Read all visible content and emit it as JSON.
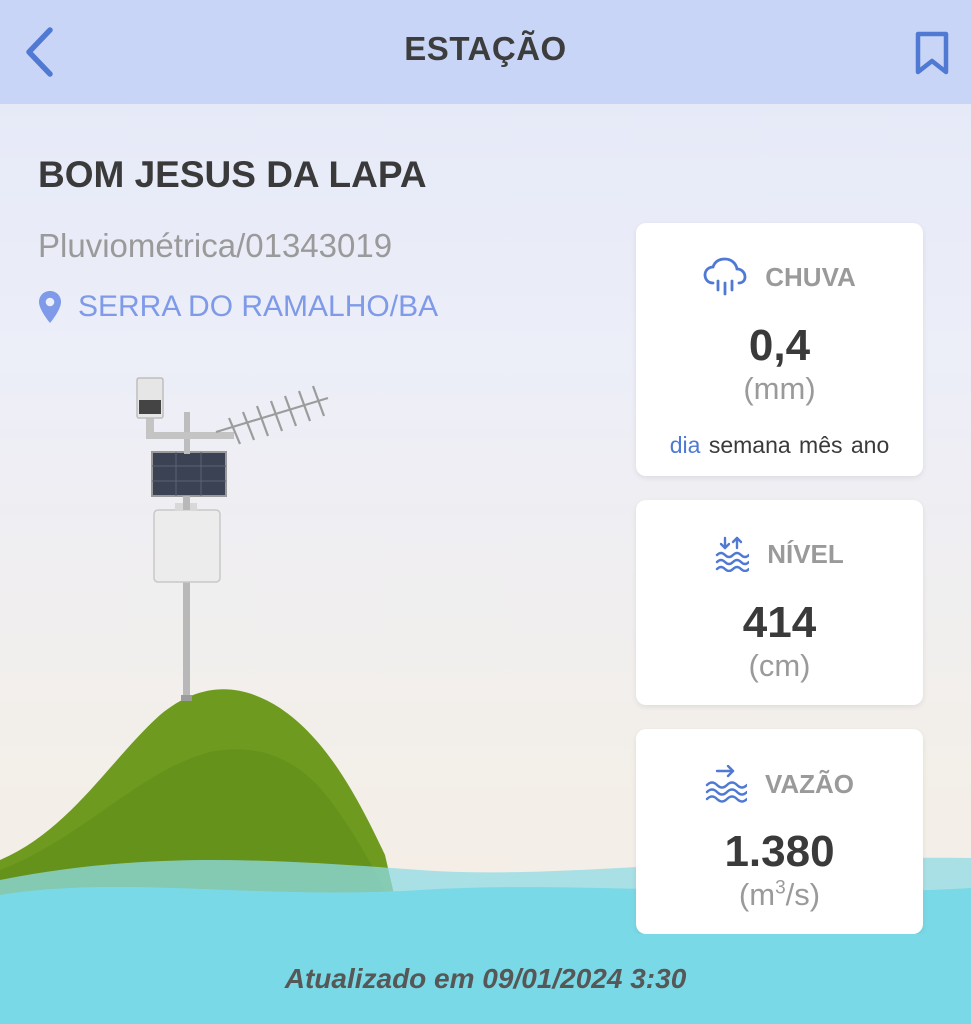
{
  "header": {
    "title": "ESTAÇÃO",
    "back_icon": "chevron-left-icon",
    "bookmark_icon": "bookmark-icon"
  },
  "station": {
    "name": "BOM JESUS DA LAPA",
    "type_code": "Pluviométrica/01343019",
    "location": "SERRA DO RAMALHO/BA"
  },
  "cards": {
    "chuva": {
      "icon": "rain-cloud-icon",
      "label": "CHUVA",
      "value": "0,4",
      "unit": "(mm)",
      "periods": [
        "dia",
        "semana",
        "mês",
        "ano"
      ],
      "active_period": "dia"
    },
    "nivel": {
      "icon": "water-level-icon",
      "label": "NÍVEL",
      "value": "414",
      "unit": "(cm)"
    },
    "vazao": {
      "icon": "water-flow-icon",
      "label": "VAZÃO",
      "value": "1.380",
      "unit_prefix": "(m",
      "unit_sup": "3",
      "unit_suffix": "/s)"
    }
  },
  "footer": {
    "updated": "Atualizado em 09/01/2024 3:30"
  },
  "colors": {
    "header_bg": "#c9d5f6",
    "accent": "#4f79d3",
    "location": "#7e9ae8",
    "hill": "#6d9a1e",
    "water": "#7ad9e6"
  }
}
